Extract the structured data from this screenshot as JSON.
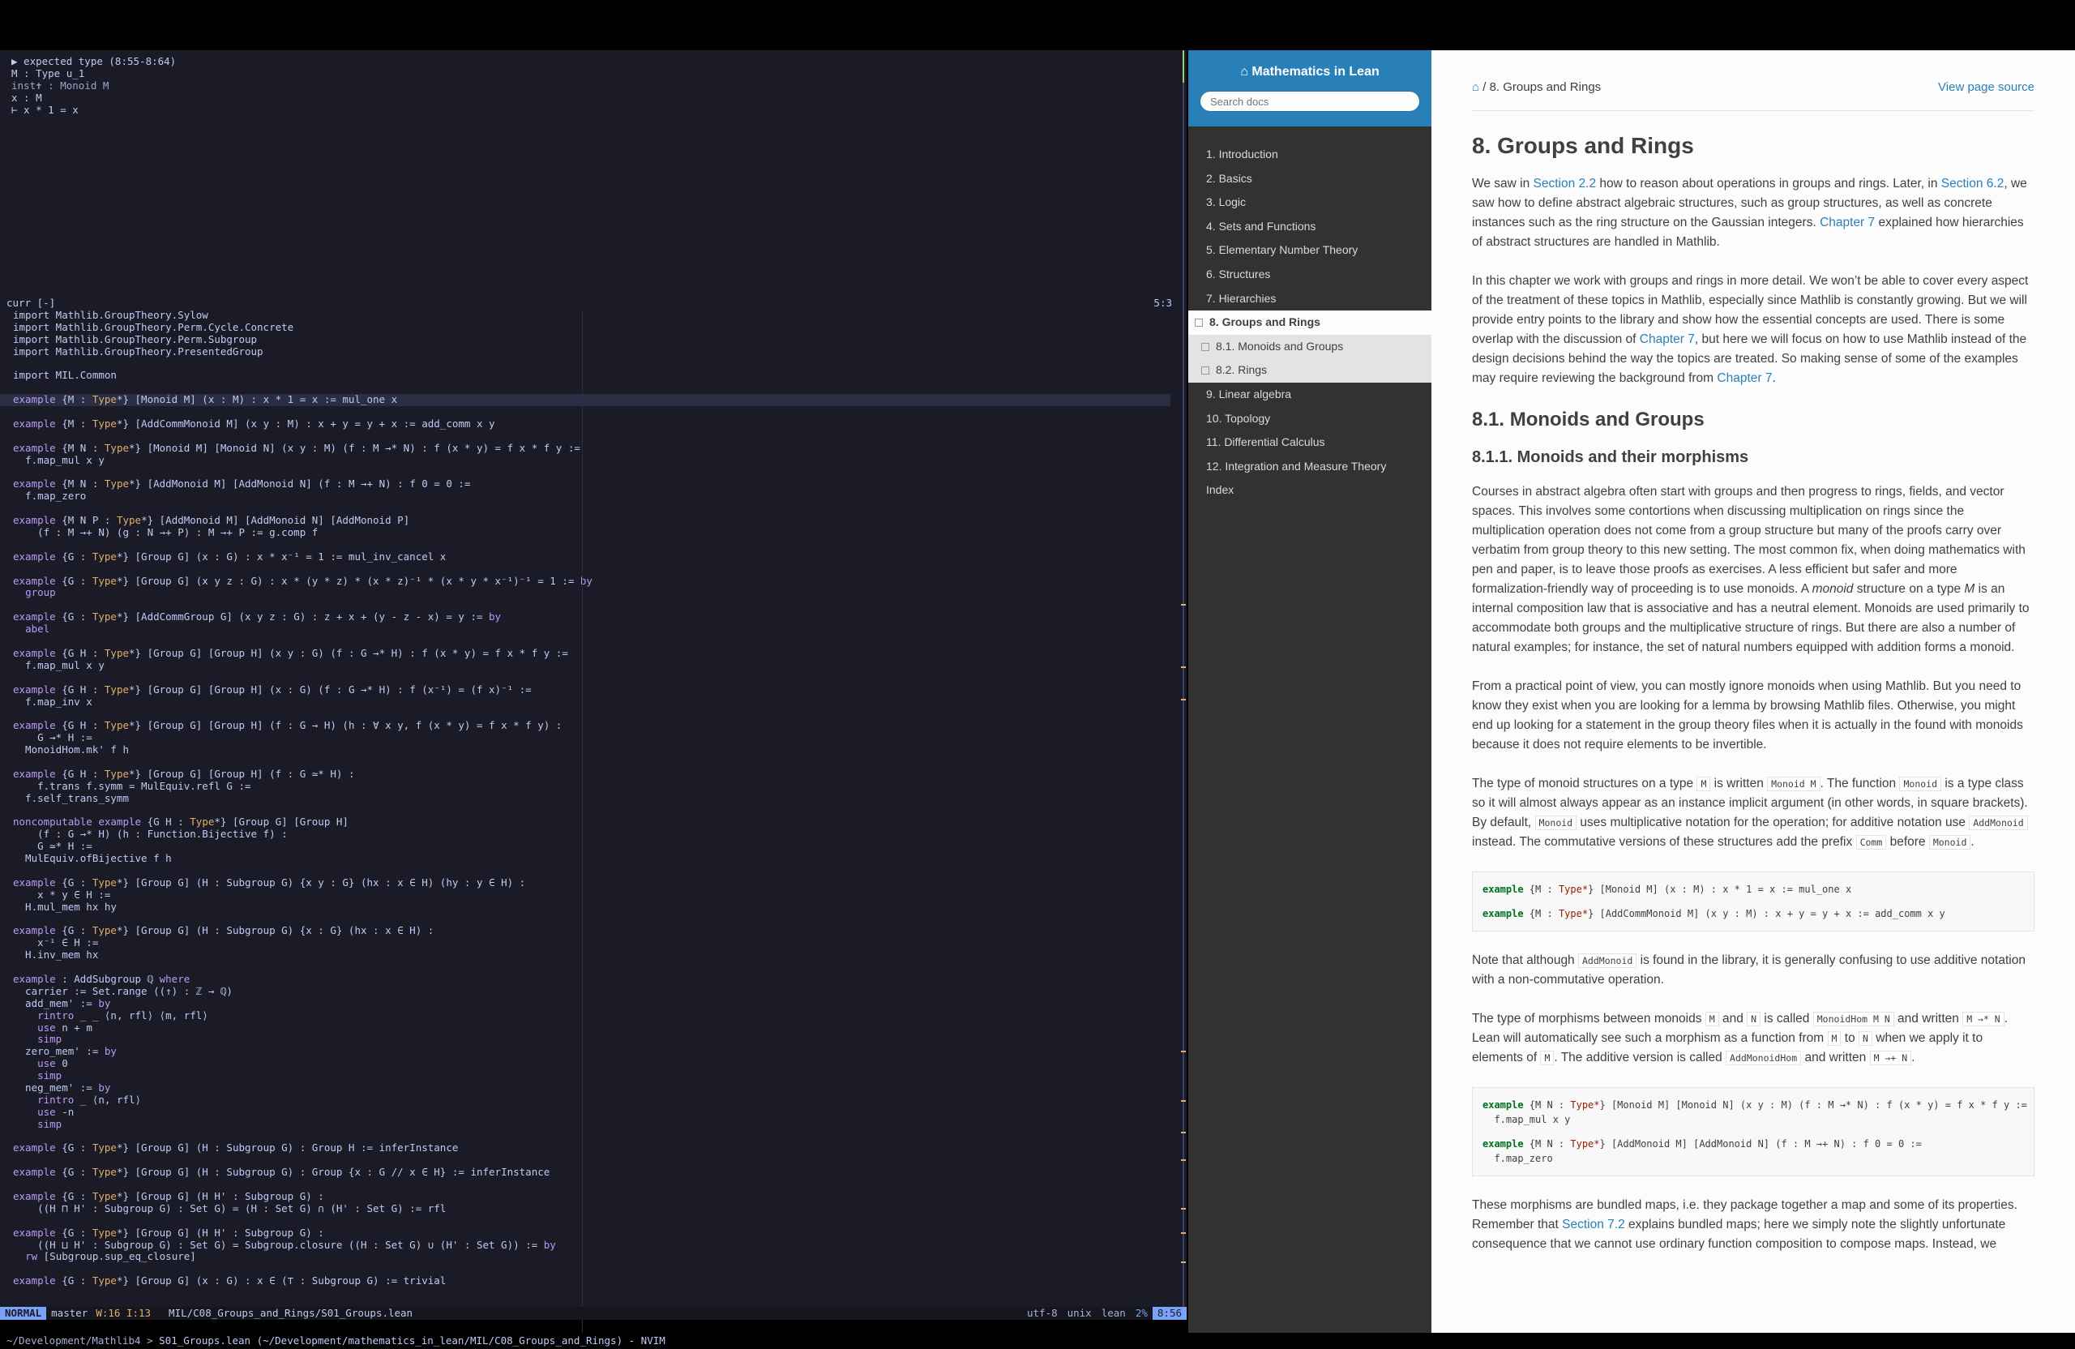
{
  "infoview": {
    "header": "▶ expected type (8:55-8:64)",
    "lines": [
      "M : Type u_1",
      "inst✝ : Monoid M",
      "x : M",
      "⊢ x * 1 = x"
    ]
  },
  "buffer_header": {
    "name": "curr [-]",
    "pos": "5:3"
  },
  "code_lines": [
    "import Mathlib.GroupTheory.Sylow",
    "import Mathlib.GroupTheory.Perm.Cycle.Concrete",
    "import Mathlib.GroupTheory.Perm.Subgroup",
    "import Mathlib.GroupTheory.PresentedGroup",
    "",
    "import MIL.Common",
    "",
    "example {M : Type*} [Monoid M] (x : M) : x * 1 = x := mul_one x",
    "",
    "example {M : Type*} [AddCommMonoid M] (x y : M) : x + y = y + x := add_comm x y",
    "",
    "example {M N : Type*} [Monoid M] [Monoid N] (x y : M) (f : M →* N) : f (x * y) = f x * f y :=",
    "  f.map_mul x y",
    "",
    "example {M N : Type*} [AddMonoid M] [AddMonoid N] (f : M →+ N) : f 0 = 0 :=",
    "  f.map_zero",
    "",
    "example {M N P : Type*} [AddMonoid M] [AddMonoid N] [AddMonoid P]",
    "    (f : M →+ N) (g : N →+ P) : M →+ P := g.comp f",
    "",
    "example {G : Type*} [Group G] (x : G) : x * x⁻¹ = 1 := mul_inv_cancel x",
    "",
    "example {G : Type*} [Group G] (x y z : G) : x * (y * z) * (x * z)⁻¹ * (x * y * x⁻¹)⁻¹ = 1 := by",
    "  group",
    "",
    "example {G : Type*} [AddCommGroup G] (x y z : G) : z + x + (y - z - x) = y := by",
    "  abel",
    "",
    "example {G H : Type*} [Group G] [Group H] (x y : G) (f : G →* H) : f (x * y) = f x * f y :=",
    "  f.map_mul x y",
    "",
    "example {G H : Type*} [Group G] [Group H] (x : G) (f : G →* H) : f (x⁻¹) = (f x)⁻¹ :=",
    "  f.map_inv x",
    "",
    "example {G H : Type*} [Group G] [Group H] (f : G → H) (h : ∀ x y, f (x * y) = f x * f y) :",
    "    G →* H :=",
    "  MonoidHom.mk' f h",
    "",
    "example {G H : Type*} [Group G] [Group H] (f : G ≃* H) :",
    "    f.trans f.symm = MulEquiv.refl G :=",
    "  f.self_trans_symm",
    "",
    "noncomputable example {G H : Type*} [Group G] [Group H]",
    "    (f : G →* H) (h : Function.Bijective f) :",
    "    G ≃* H :=",
    "  MulEquiv.ofBijective f h",
    "",
    "example {G : Type*} [Group G] (H : Subgroup G) {x y : G} (hx : x ∈ H) (hy : y ∈ H) :",
    "    x * y ∈ H :=",
    "  H.mul_mem hx hy",
    "",
    "example {G : Type*} [Group G] (H : Subgroup G) {x : G} (hx : x ∈ H) :",
    "    x⁻¹ ∈ H :=",
    "  H.inv_mem hx",
    "",
    "example : AddSubgroup ℚ where",
    "  carrier := Set.range ((↑) : ℤ → ℚ)",
    "  add_mem' := by",
    "    rintro _ _ ⟨n, rfl⟩ ⟨m, rfl⟩",
    "    use n + m",
    "    simp",
    "  zero_mem' := by",
    "    use 0",
    "    simp",
    "  neg_mem' := by",
    "    rintro _ ⟨n, rfl⟩",
    "    use -n",
    "    simp",
    "",
    "example {G : Type*} [Group G] (H : Subgroup G) : Group H := inferInstance",
    "",
    "example {G : Type*} [Group G] (H : Subgroup G) : Group {x : G // x ∈ H} := inferInstance",
    "",
    "example {G : Type*} [Group G] (H H' : Subgroup G) :",
    "    ((H ⊓ H' : Subgroup G) : Set G) = (H : Set G) ∩ (H' : Set G) := rfl",
    "",
    "example {G : Type*} [Group G] (H H' : Subgroup G) :",
    "    ((H ⊔ H' : Subgroup G) : Set G) = Subgroup.closure ((H : Set G) ∪ (H' : Set G)) := by",
    "  rw [Subgroup.sup_eq_closure]",
    "",
    "example {G : Type*} [Group G] (x : G) : x ∈ (⊤ : Subgroup G) := trivial"
  ],
  "statusline": {
    "mode": "NORMAL",
    "branch": "master",
    "diag": "W:16  I:13",
    "file": "MIL/C08_Groups_and_Rings/S01_Groups.lean",
    "encoding": "utf-8",
    "format": "unix",
    "filetype": "lean",
    "percent": "2%",
    "linecol": "8:56"
  },
  "cmdline": {
    "path": "~/Development/Mathlib4",
    "title": "S01_Groups.lean (~/Development/mathematics_in_lean/MIL/C08_Groups_and_Rings) - NVIM"
  },
  "docs": {
    "brand": "Mathematics in Lean",
    "search_placeholder": "Search docs",
    "nav": [
      {
        "label": "1. Introduction"
      },
      {
        "label": "2. Basics"
      },
      {
        "label": "3. Logic"
      },
      {
        "label": "4. Sets and Functions"
      },
      {
        "label": "5. Elementary Number Theory"
      },
      {
        "label": "6. Structures"
      },
      {
        "label": "7. Hierarchies"
      },
      {
        "label": "8. Groups and Rings"
      },
      {
        "label": "8.1. Monoids and Groups"
      },
      {
        "label": "8.2. Rings"
      },
      {
        "label": "9. Linear algebra"
      },
      {
        "label": "10. Topology"
      },
      {
        "label": "11. Differential Calculus"
      },
      {
        "label": "12. Integration and Measure Theory"
      },
      {
        "label": "Index"
      }
    ],
    "breadcrumb": "8. Groups and Rings",
    "view_source": "View page source",
    "h1": "8. Groups and Rings",
    "h2": "8.1. Monoids and Groups",
    "h3": "8.1.1. Monoids and their morphisms",
    "links": {
      "s22": "Section 2.2",
      "s62": "Section 6.2",
      "ch7": "Chapter 7",
      "s72": "Section 7.2"
    },
    "text": {
      "p1a": "We saw in ",
      "p1b": " how to reason about operations in groups and rings. Later, in ",
      "p1c": ", we saw how to define abstract algebraic structures, such as group structures, as well as concrete instances such as the ring structure on the Gaussian integers. ",
      "p1d": " explained how hierarchies of abstract structures are handled in Mathlib.",
      "p2a": "In this chapter we work with groups and rings in more detail. We won’t be able to cover every aspect of the treatment of these topics in Mathlib, especially since Mathlib is constantly growing. But we will provide entry points to the library and show how the essential concepts are used. There is some overlap with the discussion of ",
      "p2b": ", but here we will focus on how to use Mathlib instead of the design decisions behind the way the topics are treated. So making sense of some of the examples may require reviewing the background from ",
      "p2c": ".",
      "p3a": "Courses in abstract algebra often start with groups and then progress to rings, fields, and vector spaces. This involves some contortions when discussing multiplication on rings since the multiplication operation does not come from a group structure but many of the proofs carry over verbatim from group theory to this new setting. The most common fix, when doing mathematics with pen and paper, is to leave those proofs as exercises. A less efficient but safer and more formalization-friendly way of proceeding is to use monoids. A ",
      "p3em": "monoid",
      "p3b": " structure on a type ",
      "p3M": "M",
      "p3c": " is an internal composition law that is associative and has a neutral element. Monoids are used primarily to accommodate both groups and the multiplicative structure of rings. But there are also a number of natural examples; for instance, the set of natural numbers equipped with addition forms a monoid.",
      "p4": "From a practical point of view, you can mostly ignore monoids when using Mathlib. But you need to know they exist when you are looking for a lemma by browsing Mathlib files. Otherwise, you might end up looking for a statement in the group theory files when it is actually in the found with monoids because it does not require elements to be invertible.",
      "p5a": "The type of monoid structures on a type ",
      "c_M": "M",
      "p5b": " is written ",
      "c_MonoidM": "Monoid M",
      "p5c": ". The function ",
      "c_Monoid": "Monoid",
      "p5d": " is a type class so it will almost always appear as an instance implicit argument (in other words, in square brackets). By default, ",
      "p5e": " uses multiplicative notation for the operation; for additive notation use ",
      "c_AddMonoid": "AddMonoid",
      "p5f": " instead. The commutative versions of these structures add the prefix ",
      "c_Comm": "Comm",
      "p5g": " before ",
      "p5h": ".",
      "p6a": "Note that although ",
      "p6b": " is found in the library, it is generally confusing to use additive notation with a non-commutative operation.",
      "p7a": "The type of morphisms between monoids ",
      "c_N": "N",
      "p7b": " and ",
      "p7c": " is called ",
      "c_MonoidHom": "MonoidHom M N",
      "p7d": " and written ",
      "c_arrowmul": "M →* N",
      "p7e": ". Lean will automatically see such a morphism as a function from ",
      "p7f": " to ",
      "p7g": " when we apply it to elements of ",
      "p7h": ". The additive version is called ",
      "c_AddMonoidHom": "AddMonoidHom",
      "p7i": " and written ",
      "c_arrowadd": "M →+ N",
      "p7j": ".",
      "p8a": "These morphisms are bundled maps, i.e. they package together a map and some of its properties. Remember that ",
      "p8b": " explains bundled maps; here we simply note the slightly unfortunate consequence that we cannot use ordinary function composition to compose maps. Instead, we"
    },
    "block1": [
      "example {M : Type*} [Monoid M] (x : M) : x * 1 = x := mul_one x",
      "example {M : Type*} [AddCommMonoid M] (x y : M) : x + y = y + x := add_comm x y"
    ],
    "block2": [
      "example {M N : Type*} [Monoid M] [Monoid N] (x y : M) (f : M →* N) : f (x * y) = f x * f y :=",
      "  f.map_mul x y",
      "example {M N : Type*} [AddMonoid M] [AddMonoid N] (f : M →+ N) : f 0 = 0 :=",
      "  f.map_zero"
    ]
  }
}
